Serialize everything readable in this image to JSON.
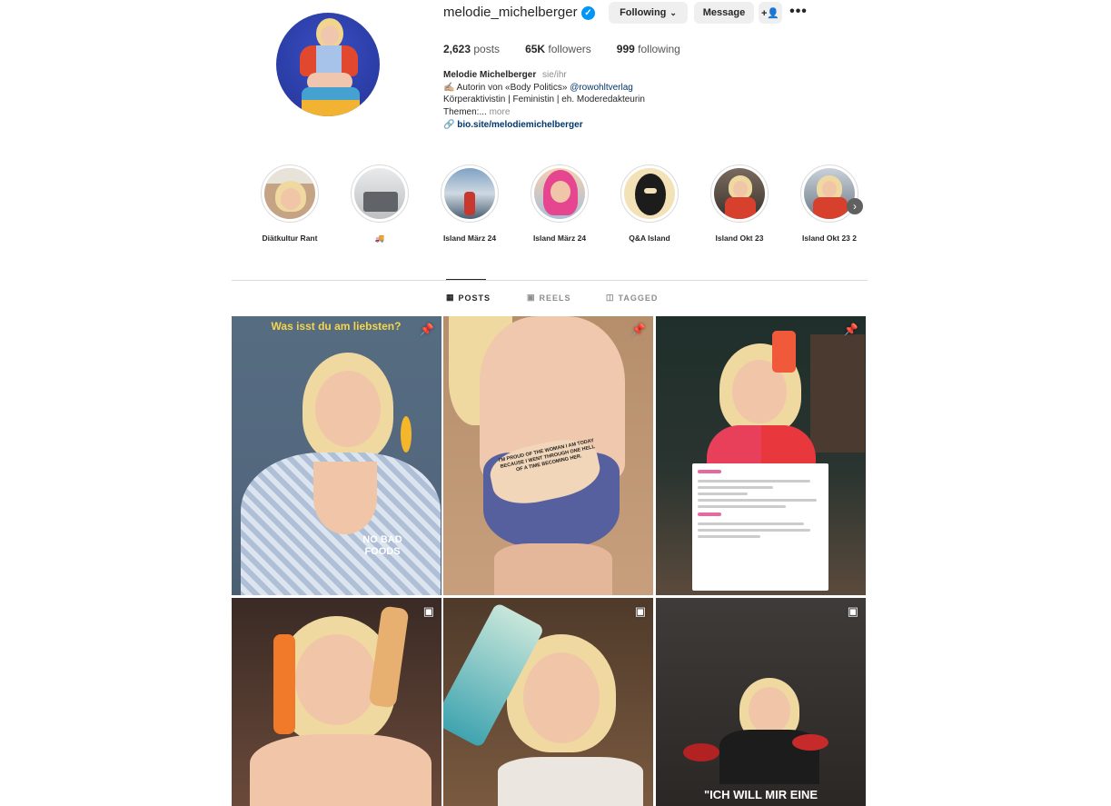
{
  "profile": {
    "username": "melodie_michelberger",
    "following_label": "Following",
    "message_label": "Message",
    "stats": {
      "posts_count": "2,623",
      "posts_label": "posts",
      "followers_count": "65K",
      "followers_label": "followers",
      "following_count": "999",
      "following_label": "following"
    },
    "bio": {
      "name": "Melodie Michelberger",
      "pronouns": "sie/ihr",
      "line1_prefix": "✍🏼 Autorin von «Body Politics»",
      "line1_tag": "@rowohltverlag",
      "line2": "Körperaktivistin | Feministin | eh. Moderedakteurin",
      "line3": "Themen:...",
      "more": "more",
      "link": "bio.site/melodiemichelberger"
    }
  },
  "highlights": [
    {
      "label": "Diätkultur Rant"
    },
    {
      "label": "🚚"
    },
    {
      "label": "Island März 24"
    },
    {
      "label": "Island März 24"
    },
    {
      "label": "Q&A Island"
    },
    {
      "label": "Island Okt 23"
    },
    {
      "label": "Island Okt 23 2"
    }
  ],
  "tabs": {
    "posts": "POSTS",
    "reels": "REELS",
    "tagged": "TAGGED"
  },
  "posts": {
    "p1_caption": "Was isst du am liebsten?",
    "p1_sign": "NO BAD FOODS",
    "p2_text": "I'M PROUD OF THE WOMAN I AM TODAY BECAUSE I WENT THROUGH ONE HELL OF A TIME BECOMING HER.",
    "p6_caption": "\"ICH WILL MIR EINE"
  }
}
